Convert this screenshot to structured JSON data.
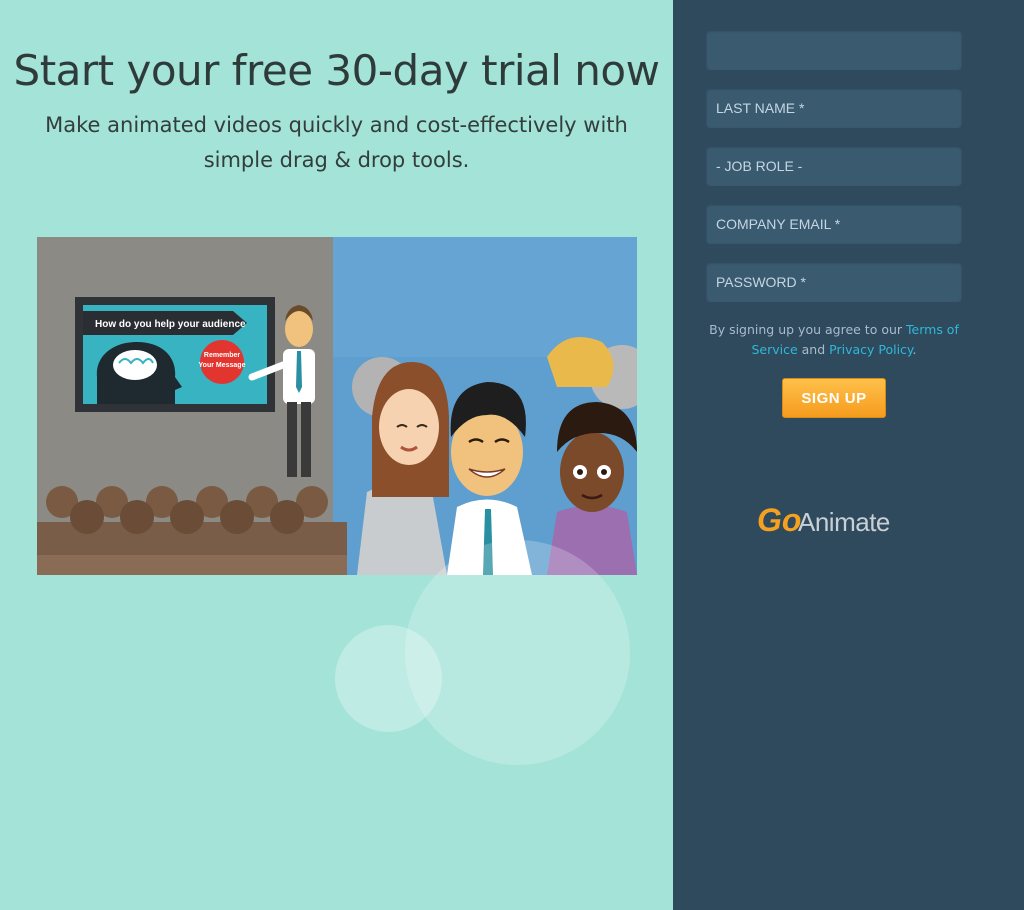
{
  "hero": {
    "headline": "Start your free 30-day trial now",
    "subheadline": "Make animated videos quickly and cost-effectively with simple drag & drop tools.",
    "video": {
      "screen_title": "How do you help your audience",
      "bubble_line1": "Remember",
      "bubble_line2": "Your Message"
    }
  },
  "form": {
    "first_name_placeholder": "",
    "last_name_placeholder": "LAST NAME *",
    "job_role_placeholder": "- JOB ROLE -",
    "company_email_placeholder": "COMPANY EMAIL *",
    "password_placeholder": "PASSWORD *",
    "terms_prefix": "By signing up you agree to our ",
    "terms_link": "Terms of Service",
    "terms_and": " and ",
    "privacy_link": "Privacy Policy",
    "terms_suffix": ".",
    "submit_label": "SIGN UP"
  },
  "logo": {
    "part1": "Go",
    "part2": "Animate"
  },
  "colors": {
    "left_bg": "#a3e3d8",
    "right_bg": "#2e4a5c",
    "field_bg": "#3a5a70",
    "link": "#2fb8d9",
    "button": "#f59c1e",
    "logo_orange": "#f5a01e",
    "logo_gray": "#c8d0d6"
  }
}
